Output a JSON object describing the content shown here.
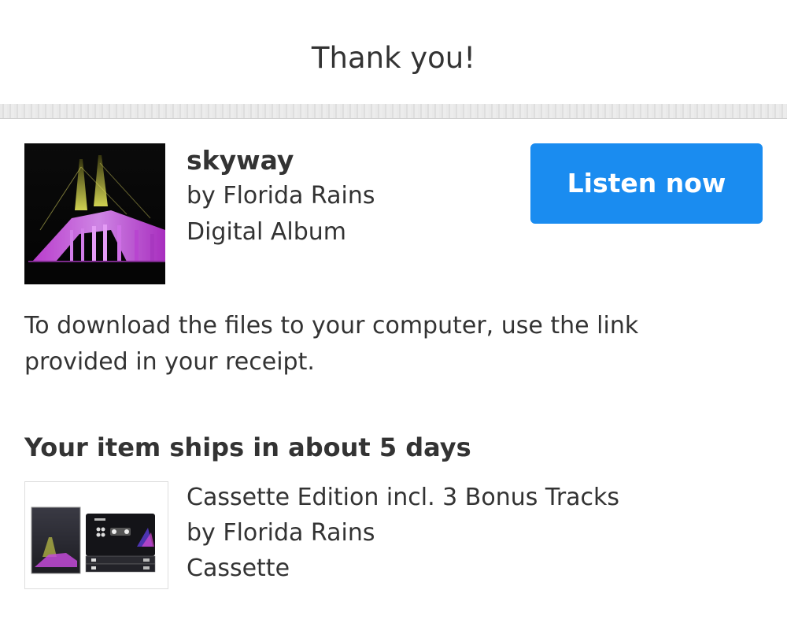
{
  "header": {
    "title": "Thank you!"
  },
  "purchase": {
    "title": "skyway",
    "artist": "by Florida Rains",
    "format": "Digital Album",
    "listen_label": "Listen now",
    "artwork_icon": "album-art-bridge-icon"
  },
  "download": {
    "note": "To download the files to your computer, use the link provided in your receipt."
  },
  "shipping": {
    "heading": "Your item ships in about 5 days",
    "item": {
      "title": "Cassette Edition incl. 3 Bonus Tracks",
      "artist": "by Florida Rains",
      "format": "Cassette",
      "thumbnail_icon": "cassette-product-icon"
    }
  },
  "colors": {
    "accent": "#1a8cf0",
    "text": "#333333",
    "background": "#ffffff"
  }
}
